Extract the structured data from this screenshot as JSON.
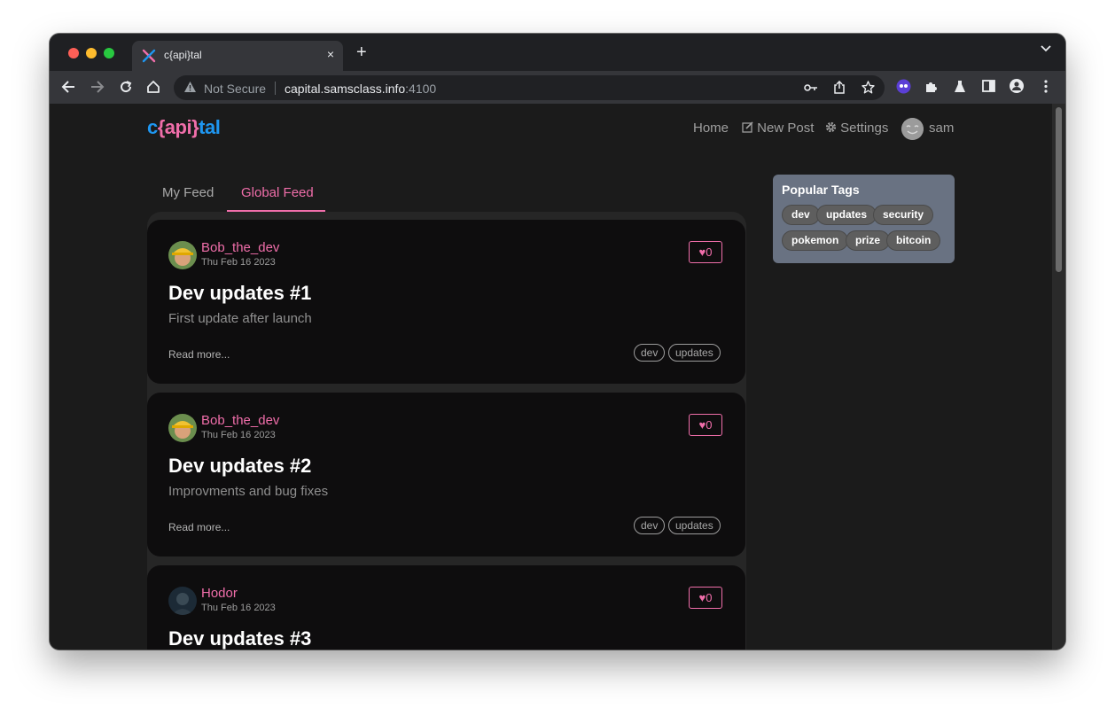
{
  "browser": {
    "tab_title": "c{api}tal",
    "new_tab_symbol": "+",
    "tab_close_symbol": "×",
    "security_label": "Not Secure",
    "url_host": "capital.samsclass.info",
    "url_port": ":4100"
  },
  "site": {
    "logo": {
      "c": "c",
      "api": "{api}",
      "tal": "tal"
    },
    "nav": {
      "home": "Home",
      "new_post": "New Post",
      "settings": "Settings",
      "user": "sam"
    }
  },
  "feed": {
    "tabs": {
      "my": "My Feed",
      "global": "Global Feed"
    },
    "read_more": "Read more...",
    "articles": [
      {
        "author": "Bob_the_dev",
        "date": "Thu Feb 16 2023",
        "likes": "0",
        "title": "Dev updates #1",
        "description": "First update after launch",
        "tags": [
          "dev",
          "updates"
        ]
      },
      {
        "author": "Bob_the_dev",
        "date": "Thu Feb 16 2023",
        "likes": "0",
        "title": "Dev updates #2",
        "description": "Improvments and bug fixes",
        "tags": [
          "dev",
          "updates"
        ]
      },
      {
        "author": "Hodor",
        "date": "Thu Feb 16 2023",
        "likes": "0",
        "title": "Dev updates #3"
      }
    ]
  },
  "sidebar": {
    "title": "Popular Tags",
    "tags": [
      "dev",
      "updates",
      "security",
      "pokemon",
      "prize",
      "bitcoin"
    ]
  },
  "colors": {
    "accent_pink": "#f06eaa",
    "accent_blue": "#1e96f0",
    "card_bg": "#0e0d0e",
    "sidebar_bg": "#697282"
  }
}
